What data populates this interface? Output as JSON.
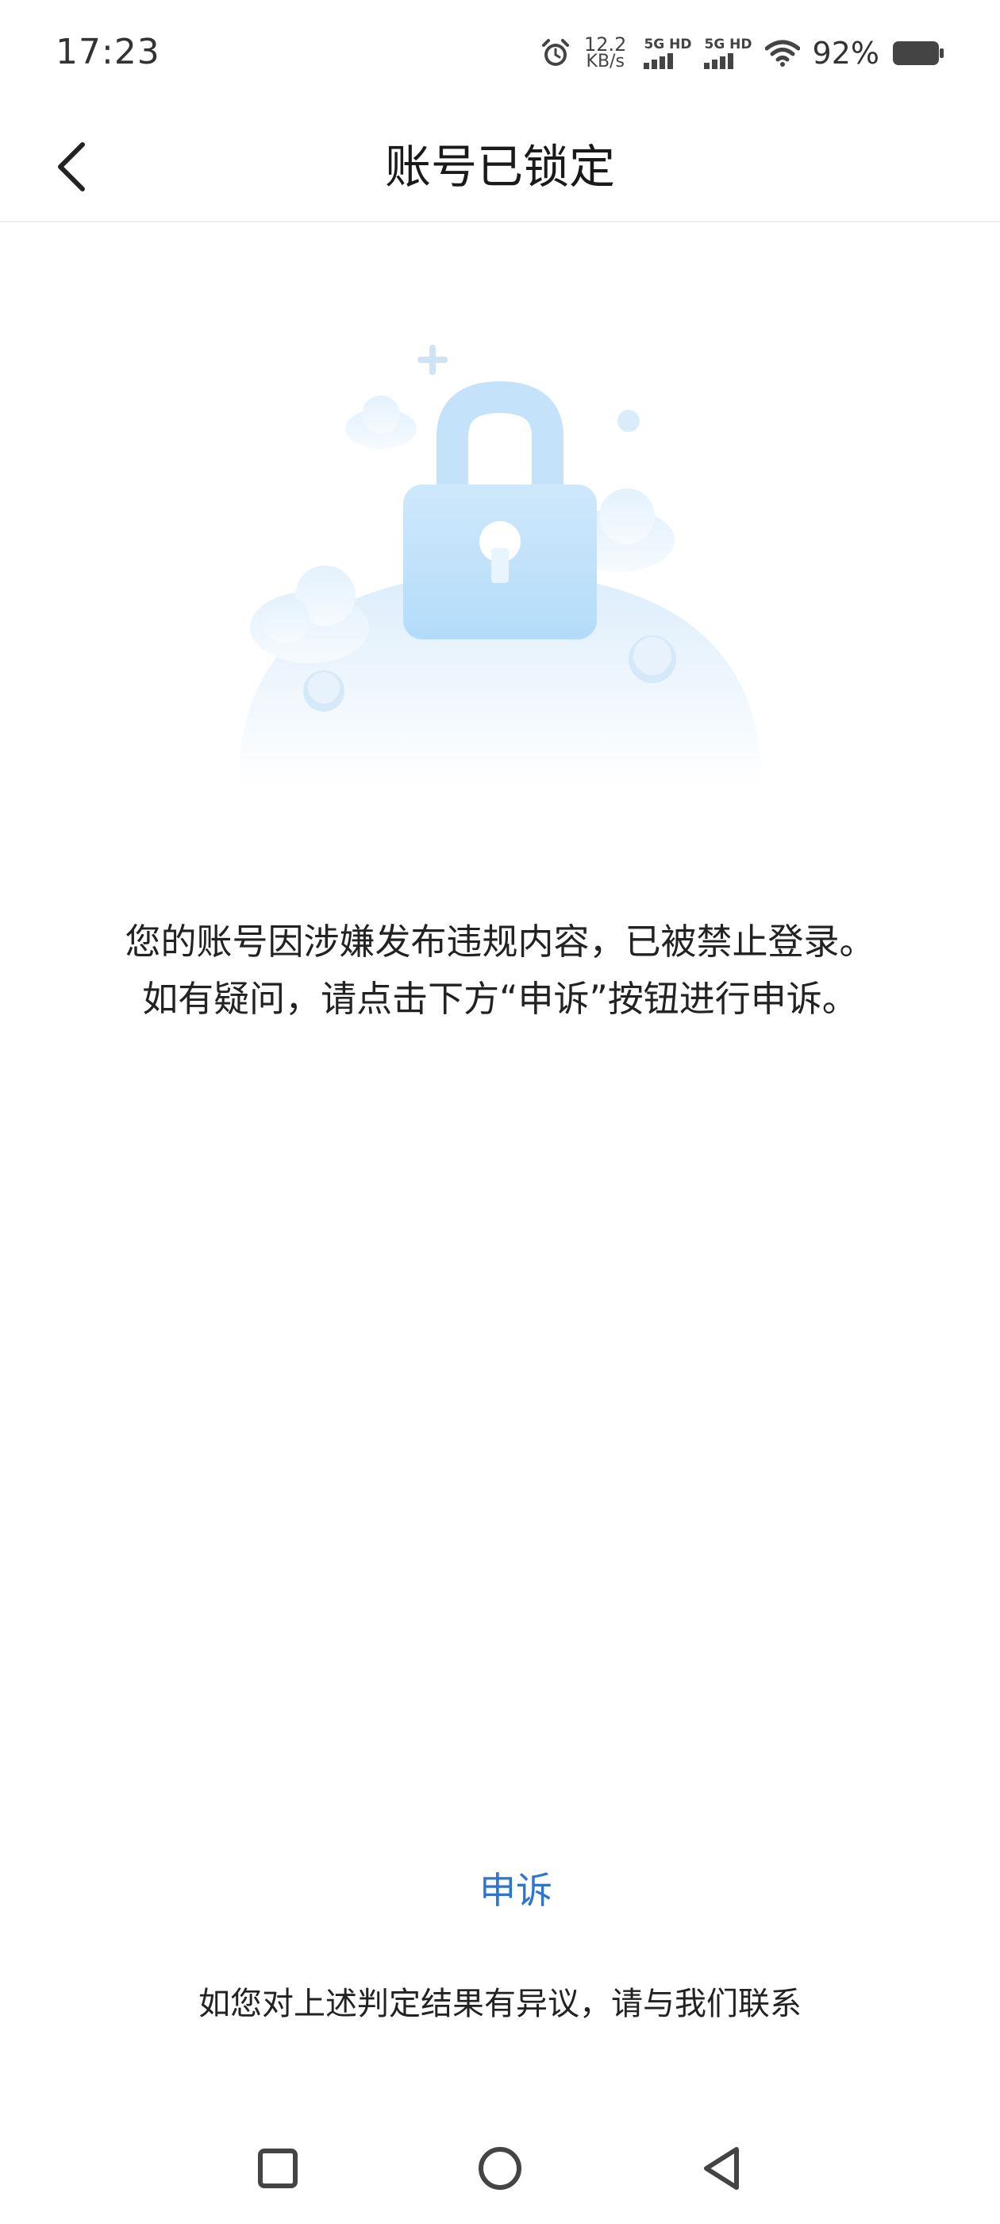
{
  "status_bar": {
    "time": "17:23",
    "net_speed_value": "12.2",
    "net_speed_unit": "KB/s",
    "sim1_label": "5G HD",
    "sim2_label": "5G HD",
    "battery": "92%",
    "icons": [
      "alarm-icon",
      "wifi-icon",
      "battery-icon"
    ]
  },
  "header": {
    "title": "账号已锁定",
    "back_icon": "chevron-left-icon"
  },
  "illustration": {
    "icon": "lock-icon",
    "accent_color": "#a9dbfb"
  },
  "message": {
    "line1": "您的账号因涉嫌发布违规内容，已被禁止登录。",
    "line2": "如有疑问，请点击下方“申诉”按钮进行申诉。"
  },
  "appeal": {
    "label": "申诉",
    "color": "#2f74d0"
  },
  "footer": {
    "note": "如您对上述判定结果有异议，请与我们联系"
  },
  "nav_bar": {
    "items": [
      "recent-apps-icon",
      "home-icon",
      "back-triangle-icon"
    ]
  }
}
